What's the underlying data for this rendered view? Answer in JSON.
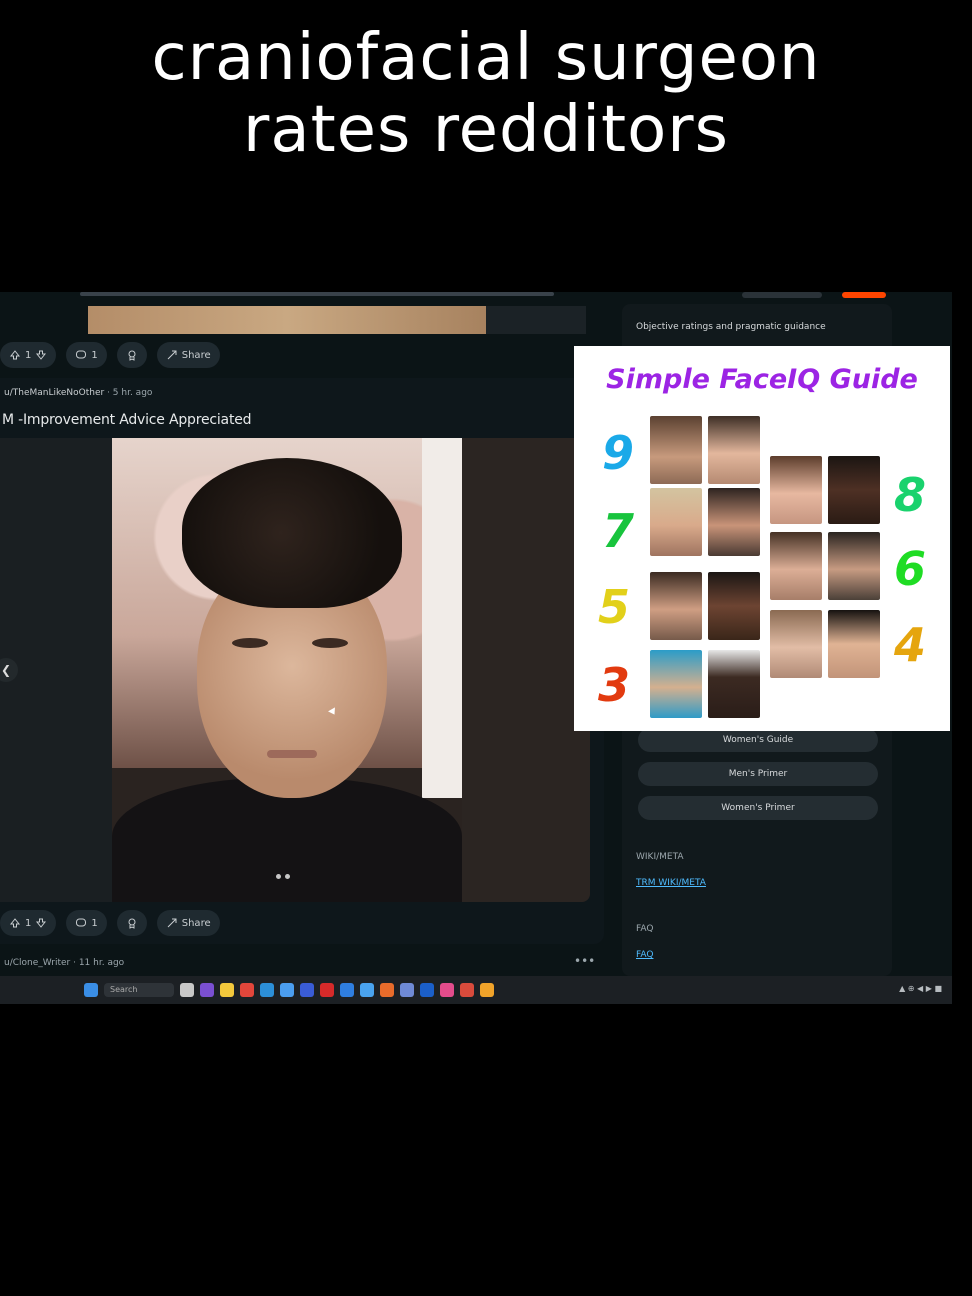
{
  "caption": {
    "line1": "craniofacial surgeon",
    "line2": "rates redditors"
  },
  "feed": {
    "top_actions": {
      "votes": "1",
      "comments": "1",
      "share": "Share"
    },
    "post": {
      "author": "u/TheManLikeNoOther",
      "time": "· 5 hr. ago",
      "title": "M -Improvement Advice Appreciated"
    },
    "bottom_actions": {
      "votes": "1",
      "comments": "1",
      "share": "Share"
    },
    "next_post": {
      "author": "u/Clone_Writer",
      "time": "· 11 hr. ago",
      "more": "•••"
    }
  },
  "sidebar": {
    "header": "Objective ratings and pragmatic guidance",
    "buttons": [
      "Women's Guide",
      "Men's Primer",
      "Women's Primer"
    ],
    "wiki_label": "WIKI/META",
    "wiki_link": "TRM WIKI/META",
    "faq_label": "FAQ",
    "faq_link": "FAQ"
  },
  "taskbar": {
    "search": "Search",
    "tray": "▲ ⊕ ◀ ▶ ■"
  },
  "overlay": {
    "title": "Simple FaceIQ Guide",
    "ratings_left": [
      "9",
      "7",
      "5",
      "3"
    ],
    "ratings_right": [
      "8",
      "6",
      "4"
    ],
    "colors": {
      "title": "#9c24e4",
      "9": "#1aa9e8",
      "8": "#19d26d",
      "7": "#18c43d",
      "6": "#1fdc24",
      "5": "#e2d01a",
      "4": "#e5a50e",
      "3": "#e23a0f"
    }
  }
}
